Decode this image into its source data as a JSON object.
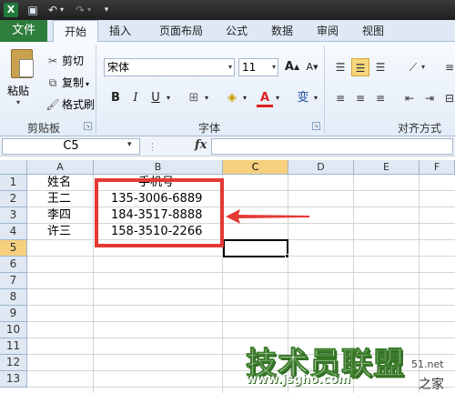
{
  "app_logo": "X",
  "tabs": [
    {
      "label": "文件"
    },
    {
      "label": "开始"
    },
    {
      "label": "插入"
    },
    {
      "label": "页面布局"
    },
    {
      "label": "公式"
    },
    {
      "label": "数据"
    },
    {
      "label": "审阅"
    },
    {
      "label": "视图"
    }
  ],
  "clipboard": {
    "paste": "粘贴",
    "cut": "剪切",
    "copy": "复制",
    "format_painter": "格式刷",
    "group_label": "剪贴板"
  },
  "font": {
    "name": "宋体",
    "size": "11",
    "grow": "A",
    "shrink": "A",
    "bold": "B",
    "italic": "I",
    "underline": "U",
    "font_color": "A",
    "phonetic": "变",
    "group_label": "字体"
  },
  "alignment": {
    "group_label": "对齐方式"
  },
  "formula_bar": {
    "name_box": "C5",
    "fx": "fx",
    "value": ""
  },
  "sheet": {
    "columns": [
      "A",
      "B",
      "C",
      "D",
      "E",
      "F"
    ],
    "selected_column": "C",
    "rows": [
      "1",
      "2",
      "3",
      "4",
      "5",
      "6",
      "7",
      "8",
      "9",
      "10",
      "11",
      "12",
      "13"
    ],
    "selected_row": "5",
    "cells": {
      "A1": "姓名",
      "B1": "手机号",
      "A2": "王二",
      "B2": "135-3006-6889",
      "A3": "李四",
      "B3": "184-3517-8888",
      "A4": "许三",
      "B4": "158-3510-2266"
    }
  },
  "annotation": {
    "box_color": "#e53935",
    "arrow_color": "#e53935"
  },
  "watermark": {
    "title": "技术员联盟",
    "url": "www.jsgho.com",
    "tail_a": "51.net",
    "tail_b": "之家"
  },
  "colors": {
    "file_tab": "#2e7d3c",
    "selected_header": "#f7d07e",
    "ribbon_bg": "#dfe9f5"
  }
}
